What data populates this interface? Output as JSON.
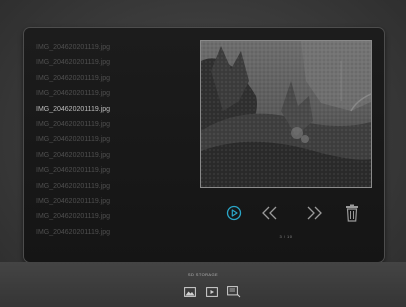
{
  "files": [
    "IMG_204620201119.jpg",
    "IMG_204620201119.jpg",
    "IMG_204620201119.jpg",
    "IMG_204620201119.jpg",
    "IMG_204620201119.jpg",
    "IMG_204620201119.jpg",
    "IMG_204620201119.jpg",
    "IMG_204620201119.jpg",
    "IMG_204620201119.jpg",
    "IMG_204620201119.jpg",
    "IMG_204620201119.jpg",
    "IMG_204620201119.jpg",
    "IMG_204620201119.jpg"
  ],
  "selected_index": 4,
  "counter": "3 / 10",
  "storage_label": "SD STORAGE",
  "controls": {
    "play_icon": "play-circle-icon",
    "prev_icon": "double-chevron-left-icon",
    "next_icon": "double-chevron-right-icon",
    "delete_icon": "trash-icon"
  },
  "modes": [
    "photo-mode-icon",
    "video-mode-icon",
    "settings-mode-icon"
  ],
  "colors": {
    "accent": "#2aa6c8",
    "selected_text": "#bdbdbd",
    "dim_text": "#4f4f4f",
    "control_gray": "#9a9a9a"
  }
}
